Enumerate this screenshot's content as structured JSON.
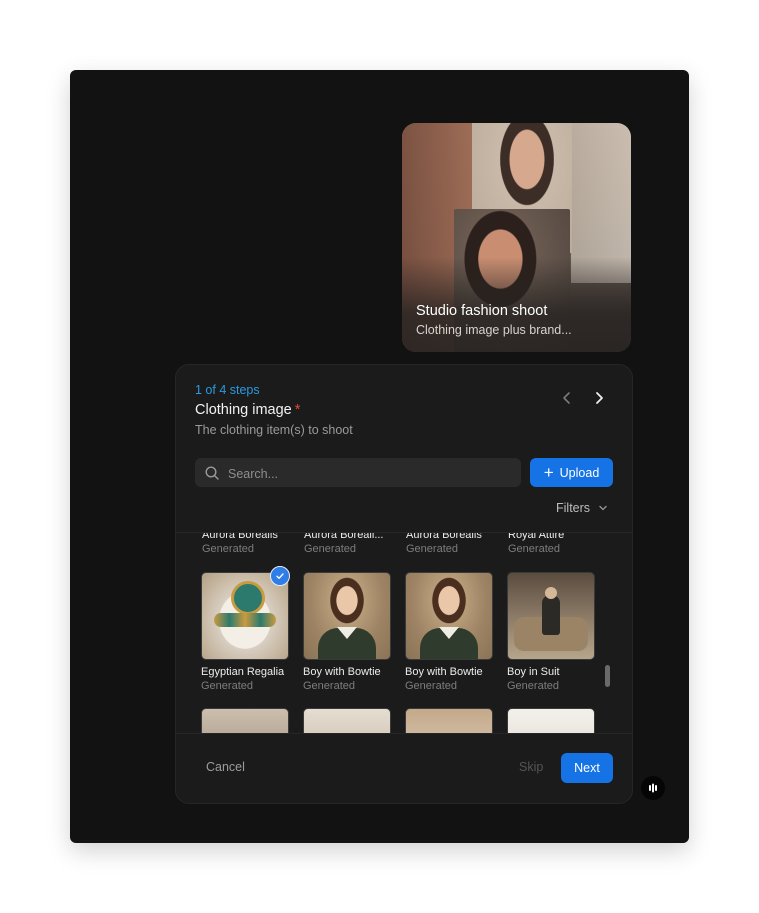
{
  "preview": {
    "title": "Studio fashion shoot",
    "subtitle": "Clothing image plus brand..."
  },
  "wizard": {
    "step_indicator": "1 of 4 steps",
    "title": "Clothing image",
    "required_mark": "*",
    "description": "The clothing item(s) to shoot"
  },
  "search": {
    "placeholder": "Search..."
  },
  "upload_label": "Upload",
  "filters_label": "Filters",
  "items": [
    {
      "name": "Aurora Borealis",
      "tag": "Generated"
    },
    {
      "name": "Aurora Boreali...",
      "tag": "Generated"
    },
    {
      "name": "Aurora Borealis",
      "tag": "Generated"
    },
    {
      "name": "Royal Attire",
      "tag": "Generated"
    },
    {
      "name": "Egyptian Regalia",
      "tag": "Generated",
      "selected": true
    },
    {
      "name": "Boy with Bowtie",
      "tag": "Generated"
    },
    {
      "name": "Boy with Bowtie",
      "tag": "Generated"
    },
    {
      "name": "Boy in Suit",
      "tag": "Generated"
    }
  ],
  "footer": {
    "cancel_label": "Cancel",
    "skip_label": "Skip",
    "next_label": "Next"
  },
  "colors": {
    "accent": "#1673e6",
    "step_text": "#2a9ae0",
    "required": "#e0473c",
    "background": "#121212",
    "panel": "#1b1b1b"
  },
  "icons": [
    "chevron-left-icon",
    "chevron-right-icon",
    "search-icon",
    "plus-icon",
    "chevron-down-icon",
    "check-icon",
    "app-logo-icon"
  ]
}
